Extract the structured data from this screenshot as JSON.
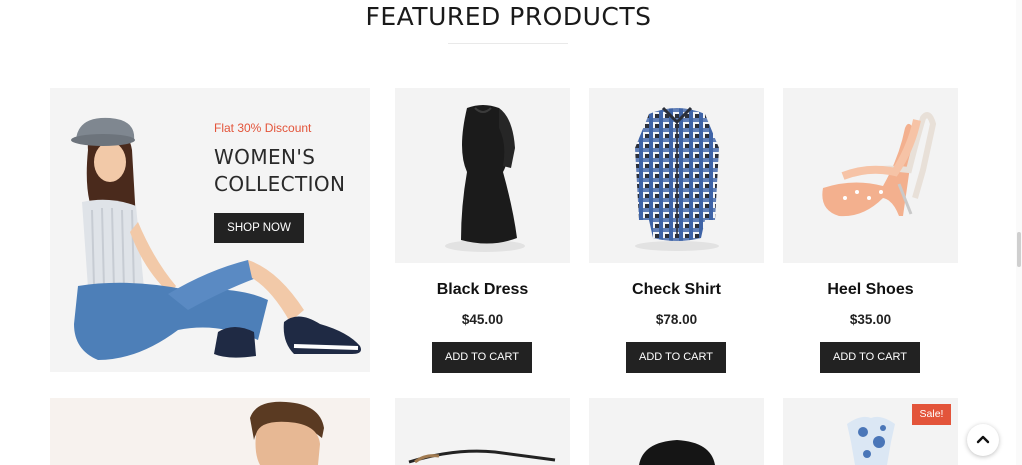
{
  "section": {
    "title": "FEATURED PRODUCTS"
  },
  "promo": {
    "eyebrow": "Flat 30% Discount",
    "heading": "WOMEN'S COLLECTION",
    "button_label": "SHOP NOW",
    "image_icon": "woman-model-image"
  },
  "products": [
    {
      "name": "Black Dress",
      "price": "$45.00",
      "button_label": "ADD TO CART",
      "image_icon": "black-dress-image"
    },
    {
      "name": "Check Shirt",
      "price": "$78.00",
      "button_label": "ADD TO CART",
      "image_icon": "check-shirt-image"
    },
    {
      "name": "Heel Shoes",
      "price": "$35.00",
      "button_label": "ADD TO CART",
      "image_icon": "heel-shoes-image"
    }
  ],
  "row2": {
    "sale_badge": "Sale!",
    "images": [
      "man-model-image",
      "sunglasses-image",
      "black-hat-image",
      "baby-romper-image"
    ]
  },
  "scroll_top": {
    "icon": "chevron-up-icon"
  },
  "colors": {
    "accent": "#e3543a",
    "button": "#222222",
    "card_bg": "#f3f3f3"
  }
}
